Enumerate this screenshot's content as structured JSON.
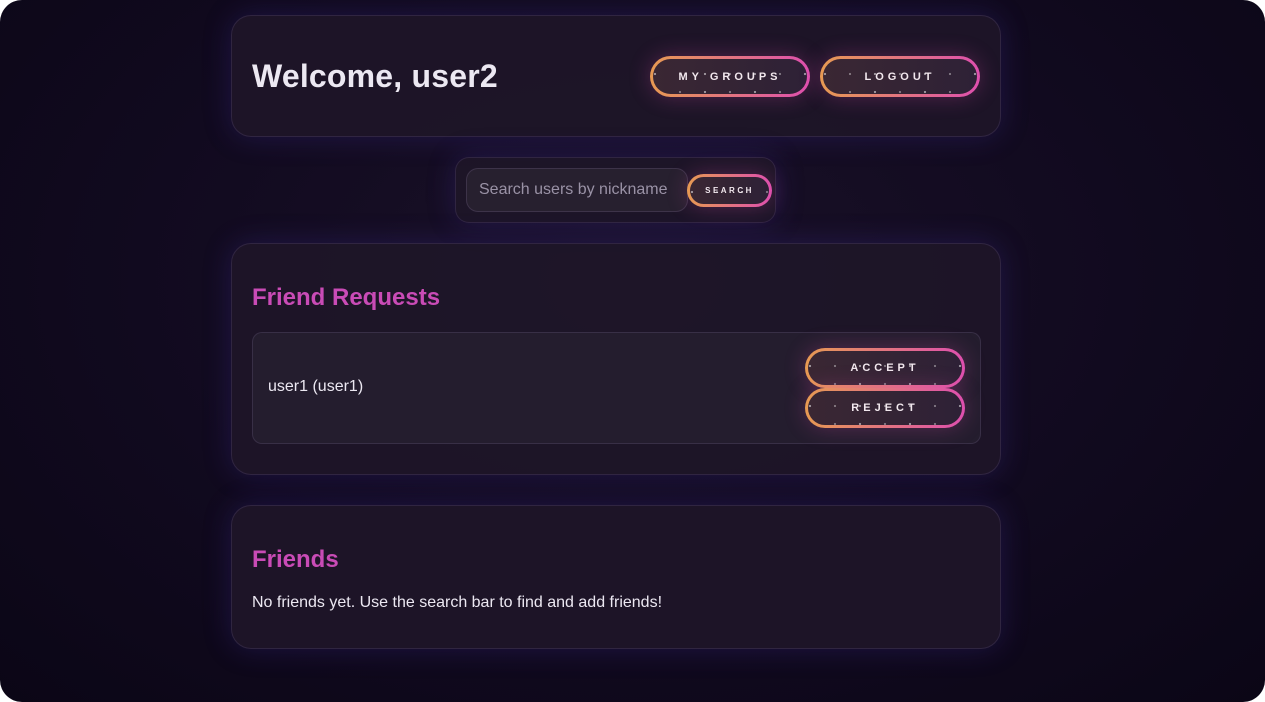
{
  "header": {
    "welcome": "Welcome, user2",
    "my_groups_label": "MY GROUPS",
    "logout_label": "LOGOUT"
  },
  "search": {
    "placeholder": "Search users by nickname",
    "value": "",
    "button_label": "SEARCH"
  },
  "friend_requests": {
    "title": "Friend Requests",
    "items": [
      {
        "name": "user1 (user1)",
        "accept_label": "ACCEPT",
        "reject_label": "REJECT"
      }
    ]
  },
  "friends": {
    "title": "Friends",
    "empty_message": "No friends yet. Use the search bar to find and add friends!"
  },
  "colors": {
    "background": "#110a1f",
    "card": "#1e1628",
    "accent_title": "#c94bb6",
    "gradient_start": "#e79a52",
    "gradient_end": "#de4fae"
  }
}
